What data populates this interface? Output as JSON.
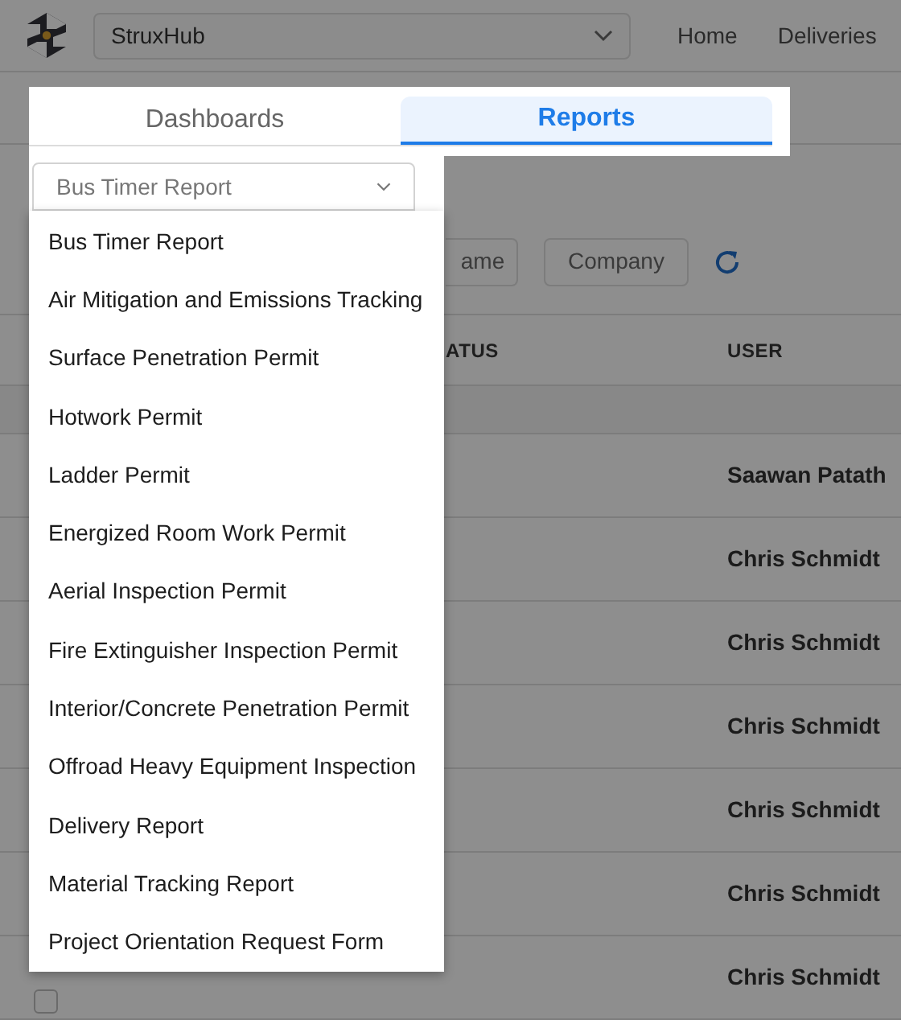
{
  "header": {
    "project_select": "StruxHub",
    "nav": [
      "Home",
      "Deliveries"
    ]
  },
  "tabs": [
    {
      "label": "Dashboards",
      "selected": false
    },
    {
      "label": "Reports",
      "selected": true
    }
  ],
  "report_select": {
    "value": "Bus Timer Report",
    "expanded": true
  },
  "menu": {
    "items": [
      "Bus Timer Report",
      "Air Mitigation and Emissions Tracking",
      "Surface Penetration Permit",
      "Hotwork Permit",
      "Ladder Permit",
      "Energized Room Work Permit",
      "Aerial Inspection Permit",
      "Fire Extinguisher Inspection Permit",
      "Interior/Concrete Penetration Permit",
      "Offroad Heavy Equipment Inspection",
      "Delivery Report",
      "Material Tracking Report",
      "Project Orientation Request Form"
    ]
  },
  "filters": [
    "ame",
    "Company"
  ],
  "table": {
    "columns": [
      "ATUS",
      "USER"
    ],
    "rows": [
      {
        "user": "Saawan Patath"
      },
      {
        "user": "Chris Schmidt"
      },
      {
        "user": "Chris Schmidt"
      },
      {
        "user": "Chris Schmidt"
      },
      {
        "user": "Chris Schmidt"
      },
      {
        "user": "Chris Schmidt"
      },
      {
        "user": "Chris Schmidt",
        "checked": false
      }
    ]
  }
}
